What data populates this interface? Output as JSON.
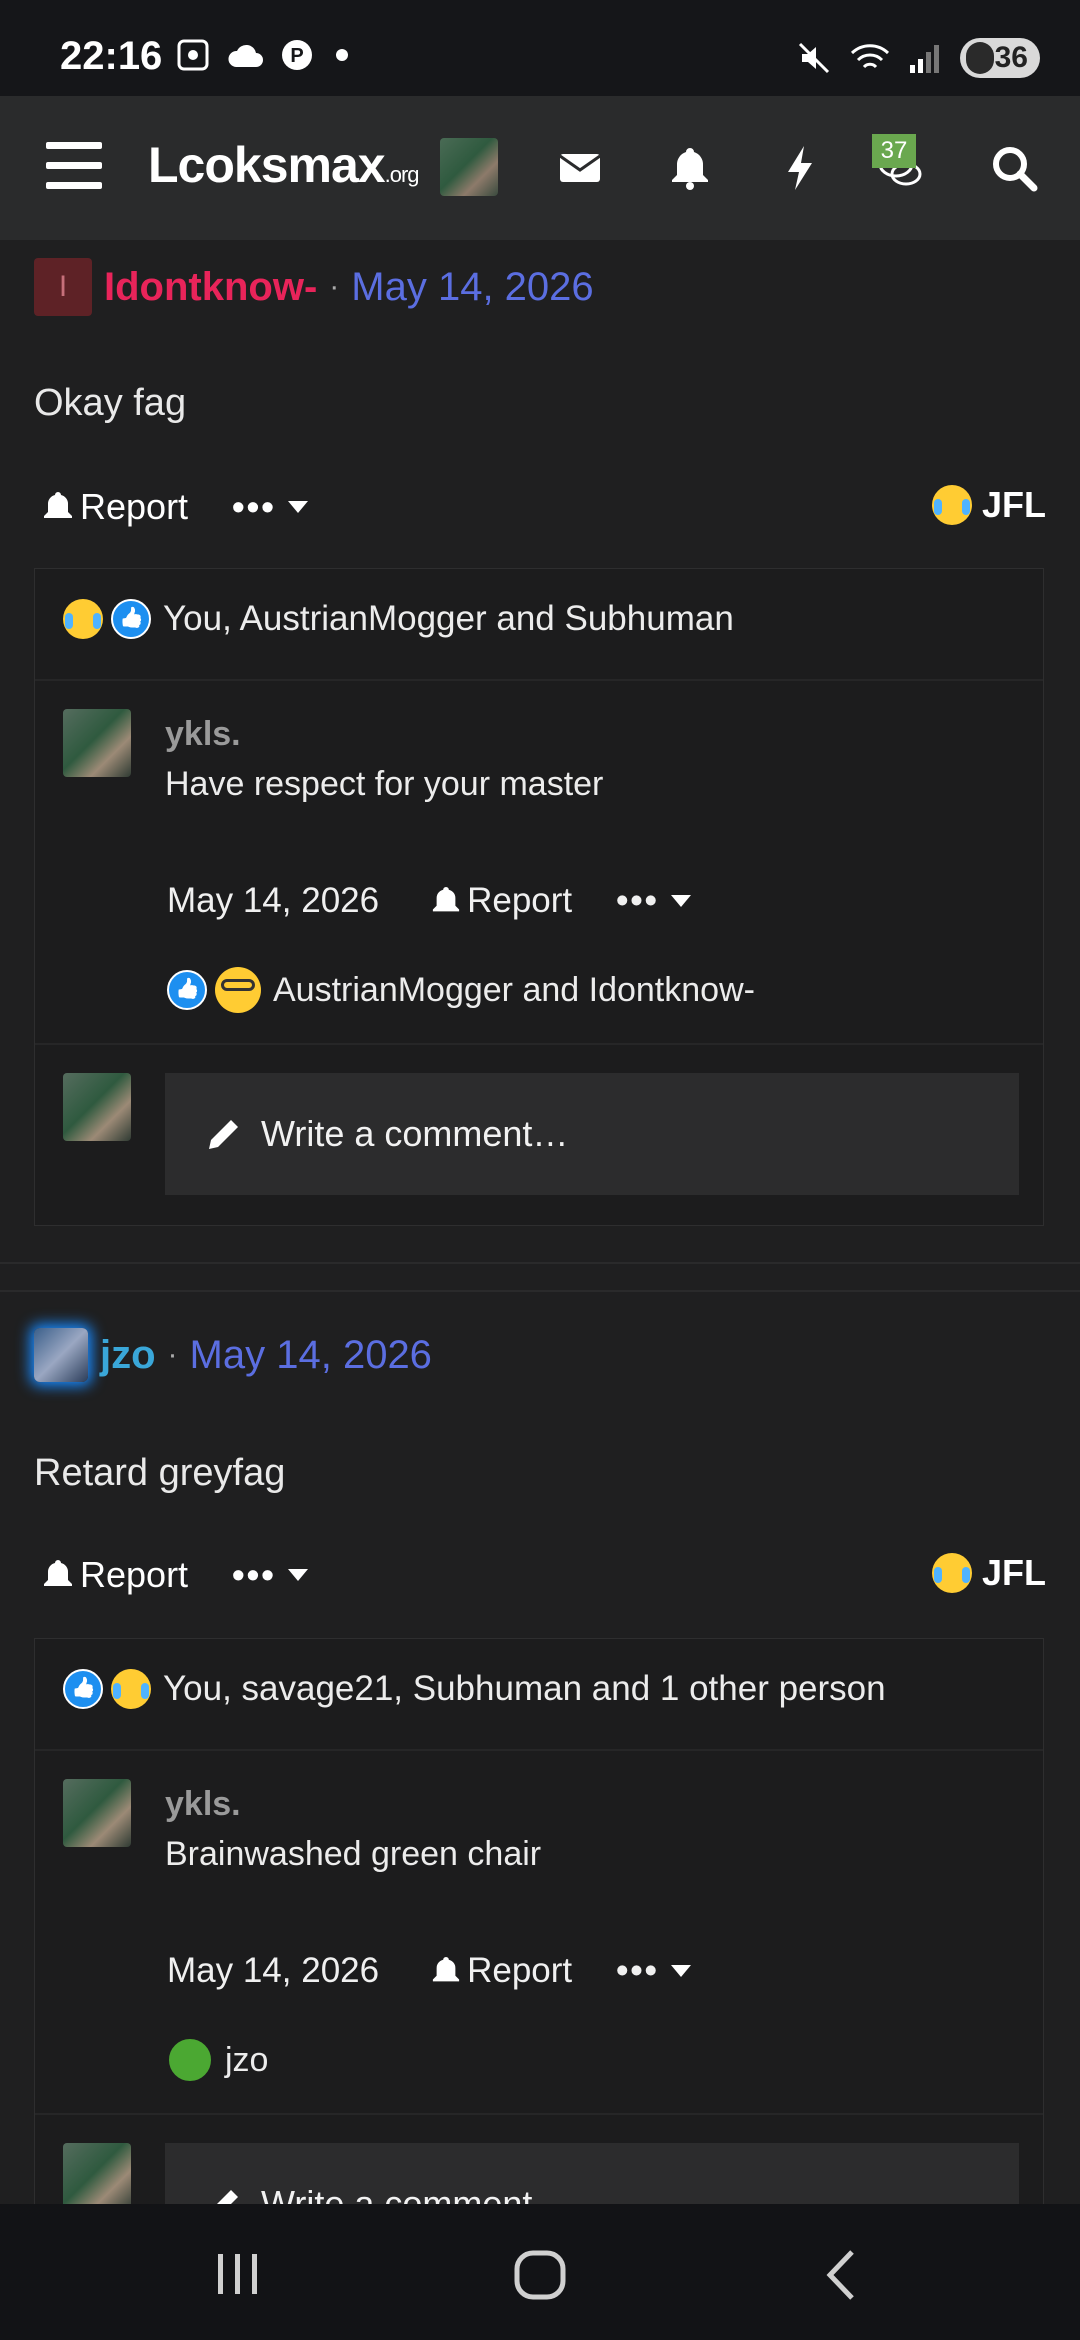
{
  "status_bar": {
    "time": "22:16",
    "battery": "36",
    "left_icons": [
      "screenshot-icon",
      "cloud-icon",
      "pinterest-icon",
      "dot-icon"
    ],
    "right_icons": [
      "mute-icon",
      "wifi-icon",
      "signal-icon",
      "battery-icon"
    ]
  },
  "header": {
    "logo_main": "Lcoksmax",
    "logo_tld": ".org",
    "badge_count": "37"
  },
  "posts": [
    {
      "author": "Idontknow-",
      "author_initial": "I",
      "author_color": "#e8245a",
      "date": "May 14, 2026",
      "body": "Okay fag",
      "report_label": "Report",
      "jfl_label": "JFL",
      "reactions_text": "You, AustrianMogger and Subhuman",
      "comment": {
        "author": "ykls.",
        "text": "Have respect for your master",
        "date": "May 14, 2026",
        "report_label": "Report",
        "reactions_text": "AustrianMogger and Idontknow-"
      },
      "write_placeholder": "Write a comment…"
    },
    {
      "author": "jzo",
      "author_color": "#3aa7d9",
      "date": "May 14, 2026",
      "body": "Retard greyfag",
      "report_label": "Report",
      "jfl_label": "JFL",
      "reactions_text": "You, savage21, Subhuman and 1 other person",
      "comment": {
        "author": "ykls.",
        "text": "Brainwashed green chair",
        "date": "May 14, 2026",
        "report_label": "Report",
        "reactions_text": "jzo"
      },
      "write_placeholder": "Write a comment…"
    }
  ],
  "colors": {
    "date_link": "#5b6ee1",
    "background": "#1f1f20",
    "header": "#2a2b2c"
  }
}
